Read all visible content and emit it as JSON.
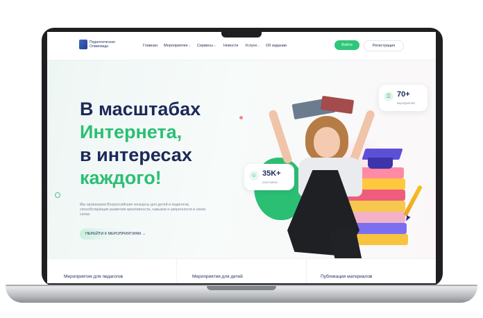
{
  "brand": {
    "logo_text": "Педагогическая Олимпиада"
  },
  "nav": [
    {
      "label": "Главная",
      "dropdown": false
    },
    {
      "label": "Мероприятия",
      "dropdown": true
    },
    {
      "label": "Сервисы",
      "dropdown": true
    },
    {
      "label": "Новости",
      "dropdown": false
    },
    {
      "label": "Услуги",
      "dropdown": true
    },
    {
      "label": "Об издании",
      "dropdown": false
    }
  ],
  "header": {
    "login_label": "Войти",
    "register_label": "Регистрация"
  },
  "hero": {
    "line1": "В масштабах",
    "line2": "Интернета,",
    "line3": "в интересах",
    "line4": "каждого!",
    "lead": "Мы организуем Всероссийские конкурсы для детей и педагогов, способствующие развитию креативности, навыков и уверенности в своих силах",
    "cta_label": "ПЕРЕЙТИ К МЕРОПРИЯТИЯМ",
    "cta_arrow": "→"
  },
  "stats": [
    {
      "value": "70+",
      "label": "мероприятий",
      "icon": "checklist-icon"
    },
    {
      "value": "35K+",
      "label": "участников",
      "icon": "users-icon"
    }
  ],
  "columns": [
    {
      "title": "Мероприятия для педагогов"
    },
    {
      "title": "Мероприятия для детей"
    },
    {
      "title": "Публикация материалов"
    }
  ],
  "colors": {
    "accent_green": "#2bbf74",
    "heading_dark": "#1c2957",
    "cta_gradient_start": "#c9f0dd"
  }
}
